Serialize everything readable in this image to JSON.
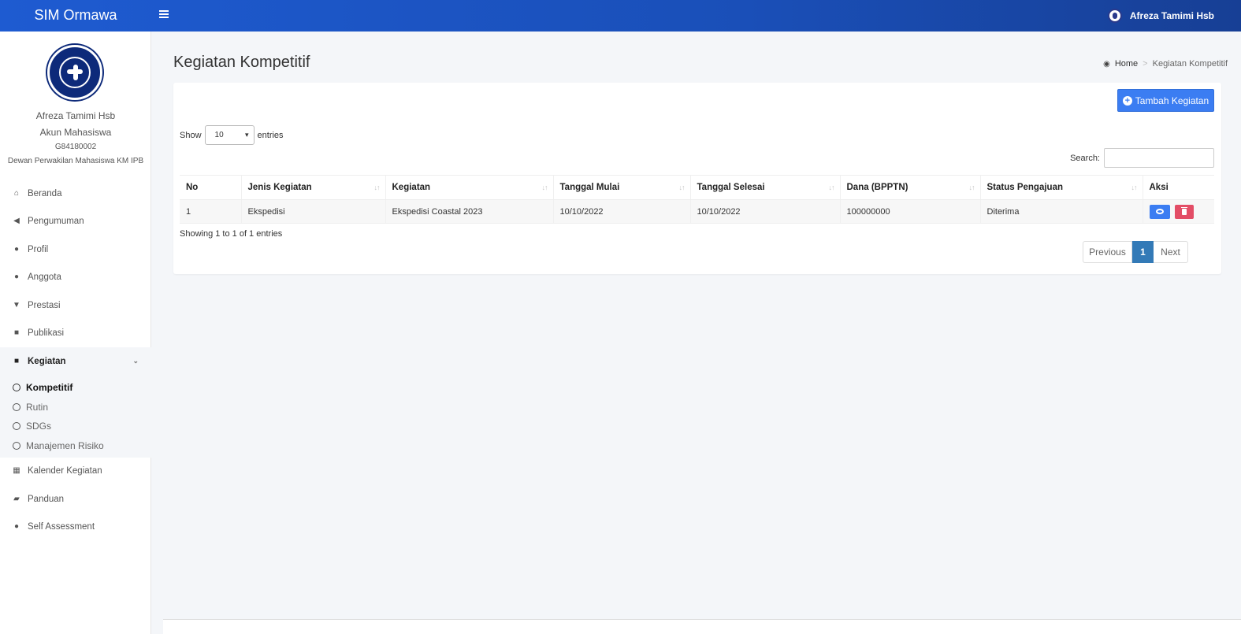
{
  "app": {
    "brand": "SIM Ormawa"
  },
  "topbar": {
    "user_name": "Afreza Tamimi Hsb"
  },
  "sidebar": {
    "user_name": "Afreza Tamimi Hsb",
    "account_type": "Akun Mahasiswa",
    "student_id": "G84180002",
    "organization": "Dewan Perwakilan Mahasiswa KM IPB",
    "items": [
      {
        "label": "Beranda",
        "icon": "home-icon"
      },
      {
        "label": "Pengumuman",
        "icon": "bullhorn-icon"
      },
      {
        "label": "Profil",
        "icon": "user-icon"
      },
      {
        "label": "Anggota",
        "icon": "users-icon"
      },
      {
        "label": "Prestasi",
        "icon": "trophy-icon"
      },
      {
        "label": "Publikasi",
        "icon": "comments-icon"
      },
      {
        "label": "Kegiatan",
        "icon": "folder-icon"
      }
    ],
    "sub_items": [
      {
        "label": "Kompetitif"
      },
      {
        "label": "Rutin"
      },
      {
        "label": "SDGs"
      },
      {
        "label": "Manajemen Risiko"
      }
    ],
    "items_after": [
      {
        "label": "Kalender Kegiatan",
        "icon": "calendar-icon"
      },
      {
        "label": "Panduan",
        "icon": "book-icon"
      },
      {
        "label": "Self Assessment",
        "icon": "user-icon"
      }
    ]
  },
  "main": {
    "title": "Kegiatan Kompetitif",
    "breadcrumb": {
      "home": "Home",
      "current": "Kegiatan Kompetitif"
    },
    "add_button": "Tambah Kegiatan",
    "show_label": "Show",
    "entries_label": "entries",
    "page_size": "10",
    "search_label": "Search:",
    "search_value": "",
    "table": {
      "headers": [
        "No",
        "Jenis Kegiatan",
        "Kegiatan",
        "Tanggal Mulai",
        "Tanggal Selesai",
        "Dana (BPPTN)",
        "Status Pengajuan",
        "Aksi"
      ],
      "rows": [
        [
          "1",
          "Ekspedisi",
          "Ekspedisi Coastal 2023",
          "10/10/2022",
          "10/10/2022",
          "100000000",
          "Diterima"
        ]
      ]
    },
    "info": "Showing 1 to 1 of 1 entries",
    "pager": {
      "previous": "Previous",
      "current": "1",
      "next": "Next"
    }
  },
  "colors": {
    "topbar": "#1e5bd1",
    "primary_button": "#3b7df2",
    "delete_button": "#e34d66",
    "active_page": "#337ab7"
  }
}
